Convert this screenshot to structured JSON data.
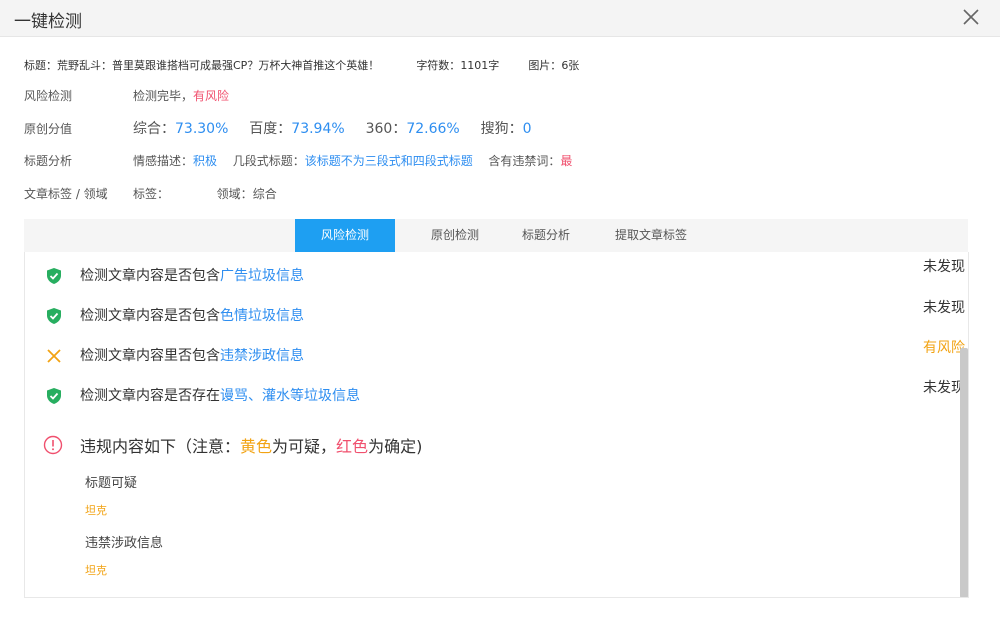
{
  "dialog": {
    "title": "一键检测"
  },
  "info": {
    "title_label": "标题：",
    "title_value": "荒野乱斗：普里莫跟谁搭档可成最强CP？万杯大神首推这个英雄！",
    "word_count_label": "字符数：",
    "word_count_value": "1101字",
    "images_label": "图片：",
    "images_value": "6张"
  },
  "summary": {
    "risk": {
      "label": "风险检测",
      "status": "检测完毕，",
      "result": "有风险"
    },
    "originality": {
      "label": "原创分值",
      "overall_label": "综合：",
      "overall_value": "73.30%",
      "baidu_label": "百度：",
      "baidu_value": "73.94%",
      "s360_label": "360：",
      "s360_value": "72.66%",
      "sogou_label": "搜狗：",
      "sogou_value": "0"
    },
    "title_analysis": {
      "label": "标题分析",
      "sentiment_label": "情感描述：",
      "sentiment_value": "积极",
      "segments_label": "几段式标题：",
      "segments_value": "该标题不为三段式和四段式标题",
      "banned_label": "含有违禁词：",
      "banned_value": "最"
    },
    "tags": {
      "label": "文章标签 / 领域",
      "tag_label": "标签：",
      "domain_label": "领域：",
      "domain_value": "综合"
    }
  },
  "tabs": [
    {
      "label": "风险检测",
      "active": true
    },
    {
      "label": "原创检测",
      "active": false
    },
    {
      "label": "标题分析",
      "active": false
    },
    {
      "label": "提取文章标签",
      "active": false
    }
  ],
  "checks": [
    {
      "prefix": "检测文章内容是否包含",
      "highlight": "广告垃圾信息",
      "status": "未发现",
      "icon": "shield-check-icon"
    },
    {
      "prefix": "检测文章内容是否包含",
      "highlight": "色情垃圾信息",
      "status": "未发现",
      "icon": "shield-check-icon"
    },
    {
      "prefix": "检测文章内容里否包含",
      "highlight": "违禁涉政信息",
      "status": "有风险",
      "icon": "cross-icon"
    },
    {
      "prefix": "检测文章内容是否存在",
      "highlight": "谩骂、灌水等垃圾信息",
      "status": "未发现",
      "icon": "shield-check-icon"
    }
  ],
  "violations": {
    "heading_prefix": "违规内容如下（注意：",
    "yellow_word": "黄色",
    "mid": "为可疑，",
    "red_word": "红色",
    "suffix": "为确定)",
    "items": [
      {
        "category": "标题可疑",
        "word": "坦克"
      },
      {
        "category": "违禁涉政信息",
        "word": "坦克"
      }
    ]
  },
  "colors": {
    "accent": "#1e9ff2",
    "link": "#2e8ef0",
    "risk_red": "#f0506e",
    "warn_yellow": "#f2a313",
    "safe_green": "#27ae60"
  }
}
